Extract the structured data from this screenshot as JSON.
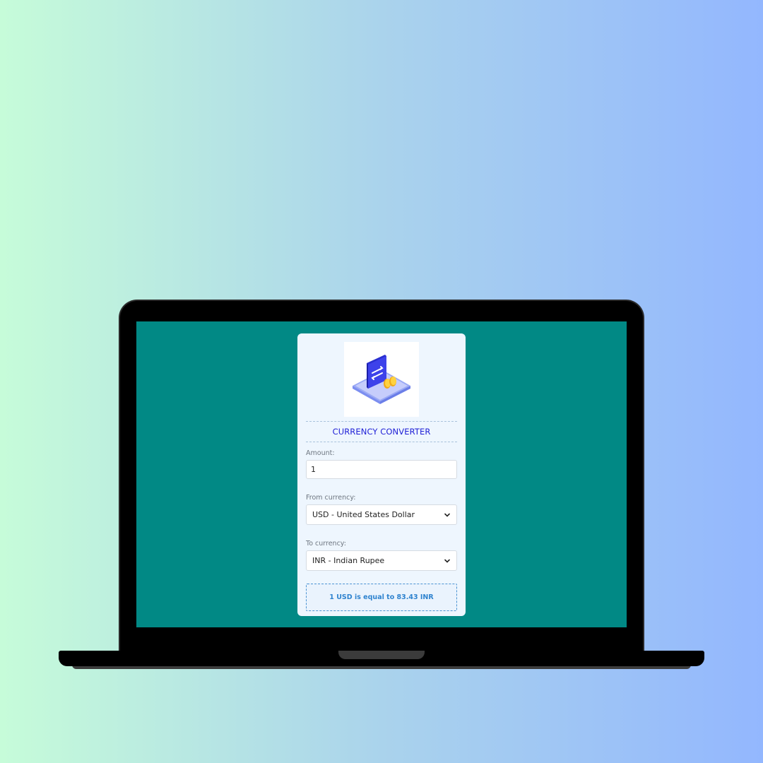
{
  "app": {
    "title": "CURRENCY CONVERTER"
  },
  "logo": {
    "icon": "currency-exchange-icon"
  },
  "amount": {
    "label": "Amount:",
    "value": "1"
  },
  "from_currency": {
    "label": "From currency:",
    "selected": "USD - United States Dollar"
  },
  "to_currency": {
    "label": "To currency:",
    "selected": "INR - Indian Rupee"
  },
  "result": {
    "text": "1 USD is equal to 83.43 INR"
  },
  "colors": {
    "background_gradient_start": "#c6fcd9",
    "background_gradient_end": "#93b7fe",
    "screen": "#018985",
    "card": "#eef6fe",
    "title": "#1f1fd6",
    "result_text": "#2f83cf"
  }
}
